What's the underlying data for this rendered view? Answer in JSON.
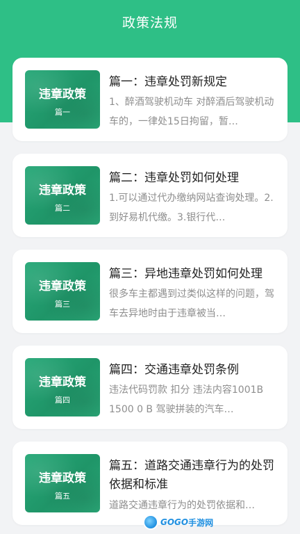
{
  "header": {
    "title": "政策法规"
  },
  "articles": [
    {
      "thumb_title": "违章政策",
      "thumb_sub": "篇一",
      "title": "篇一：违章处罚新规定",
      "desc": "1、醉酒驾驶机动车 对醉酒后驾驶机动车的，一律处15日拘留，暂…"
    },
    {
      "thumb_title": "违章政策",
      "thumb_sub": "篇二",
      "title": "篇二：违章处罚如何处理",
      "desc": "1.可以通过代办缴纳网站查询处理。2.到好易机代缴。3.银行代…"
    },
    {
      "thumb_title": "违章政策",
      "thumb_sub": "篇三",
      "title": "篇三：异地违章处罚如何处理",
      "desc": "很多车主都遇到过类似这样的问题，驾车去异地时由于违章被当…"
    },
    {
      "thumb_title": "违章政策",
      "thumb_sub": "篇四",
      "title": "篇四：交通违章处罚条例",
      "desc": "违法代码罚款 扣分 违法内容1001B 1500 0 B 驾驶拼装的汽车…"
    },
    {
      "thumb_title": "违章政策",
      "thumb_sub": "篇五",
      "title": "篇五：道路交通违章行为的处罚依据和标准",
      "desc": "道路交通违章行为的处罚依据和…"
    }
  ],
  "watermark": {
    "brand": "GOGO",
    "suffix": "手游网",
    "icon": "gogo-logo-icon"
  }
}
